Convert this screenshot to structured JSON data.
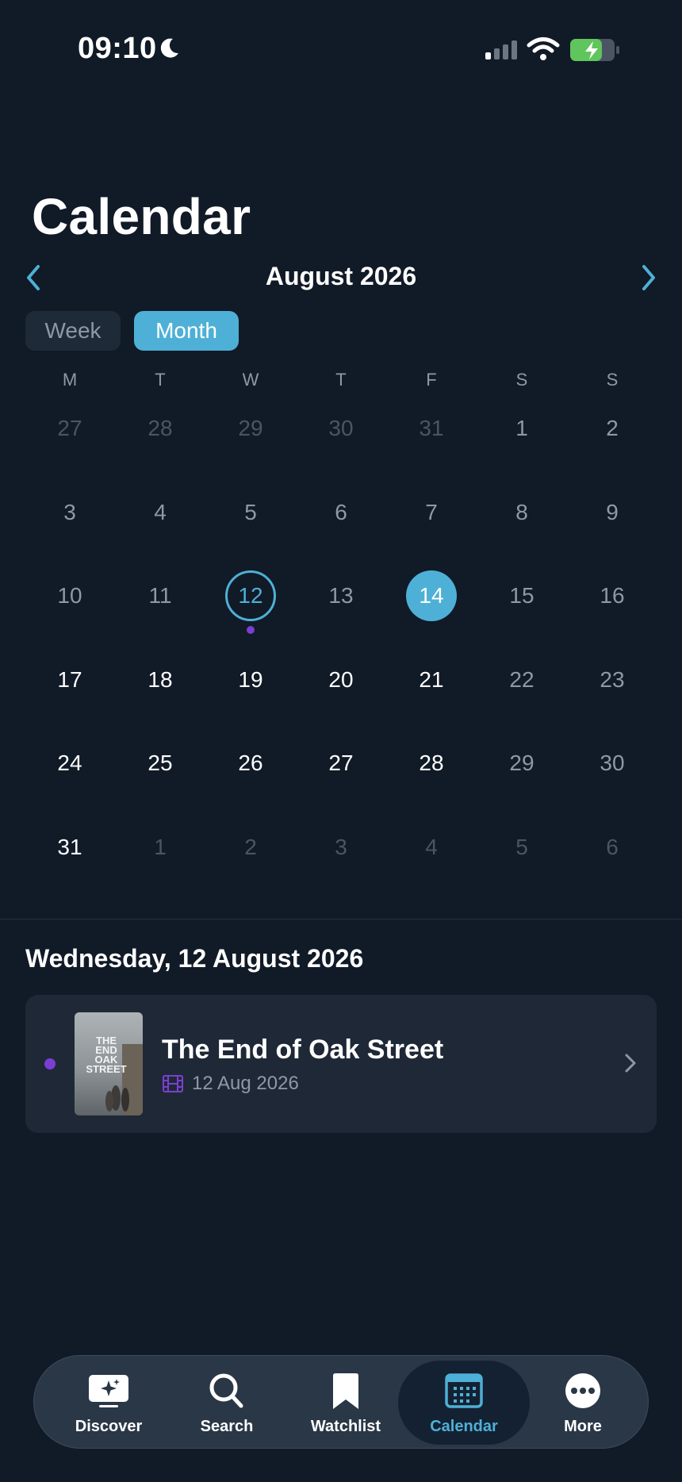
{
  "status_bar": {
    "time": "09:10"
  },
  "title": "Calendar",
  "month_label": "August 2026",
  "view_toggle": {
    "week": "Week",
    "month": "Month",
    "active": "Month"
  },
  "weekdays": [
    "M",
    "T",
    "W",
    "T",
    "F",
    "S",
    "S"
  ],
  "weeks": [
    [
      "27",
      "28",
      "29",
      "30",
      "31",
      "1",
      "2"
    ],
    [
      "3",
      "4",
      "5",
      "6",
      "7",
      "8",
      "9"
    ],
    [
      "10",
      "11",
      "12",
      "13",
      "14",
      "15",
      "16"
    ],
    [
      "17",
      "18",
      "19",
      "20",
      "21",
      "22",
      "23"
    ],
    [
      "24",
      "25",
      "26",
      "27",
      "28",
      "29",
      "30"
    ],
    [
      "31",
      "1",
      "2",
      "3",
      "4",
      "5",
      "6"
    ]
  ],
  "selected_day": "12",
  "today": "14",
  "event_days": [
    "12"
  ],
  "selected_date_heading": "Wednesday, 12 August 2026",
  "event": {
    "title": "The End of Oak Street",
    "date": "12 Aug 2026",
    "poster_text": "THE\nEND\nOAK\nSTREET",
    "type_icon": "film-icon"
  },
  "tabs": [
    {
      "label": "Discover",
      "icon": "discover-icon"
    },
    {
      "label": "Search",
      "icon": "search-icon"
    },
    {
      "label": "Watchlist",
      "icon": "bookmark-icon"
    },
    {
      "label": "Calendar",
      "icon": "calendar-icon"
    },
    {
      "label": "More",
      "icon": "more-icon"
    }
  ],
  "active_tab": "Calendar",
  "colors": {
    "accent": "#4eb0d6",
    "event_dot": "#7a3fd1",
    "background": "#111a27"
  }
}
